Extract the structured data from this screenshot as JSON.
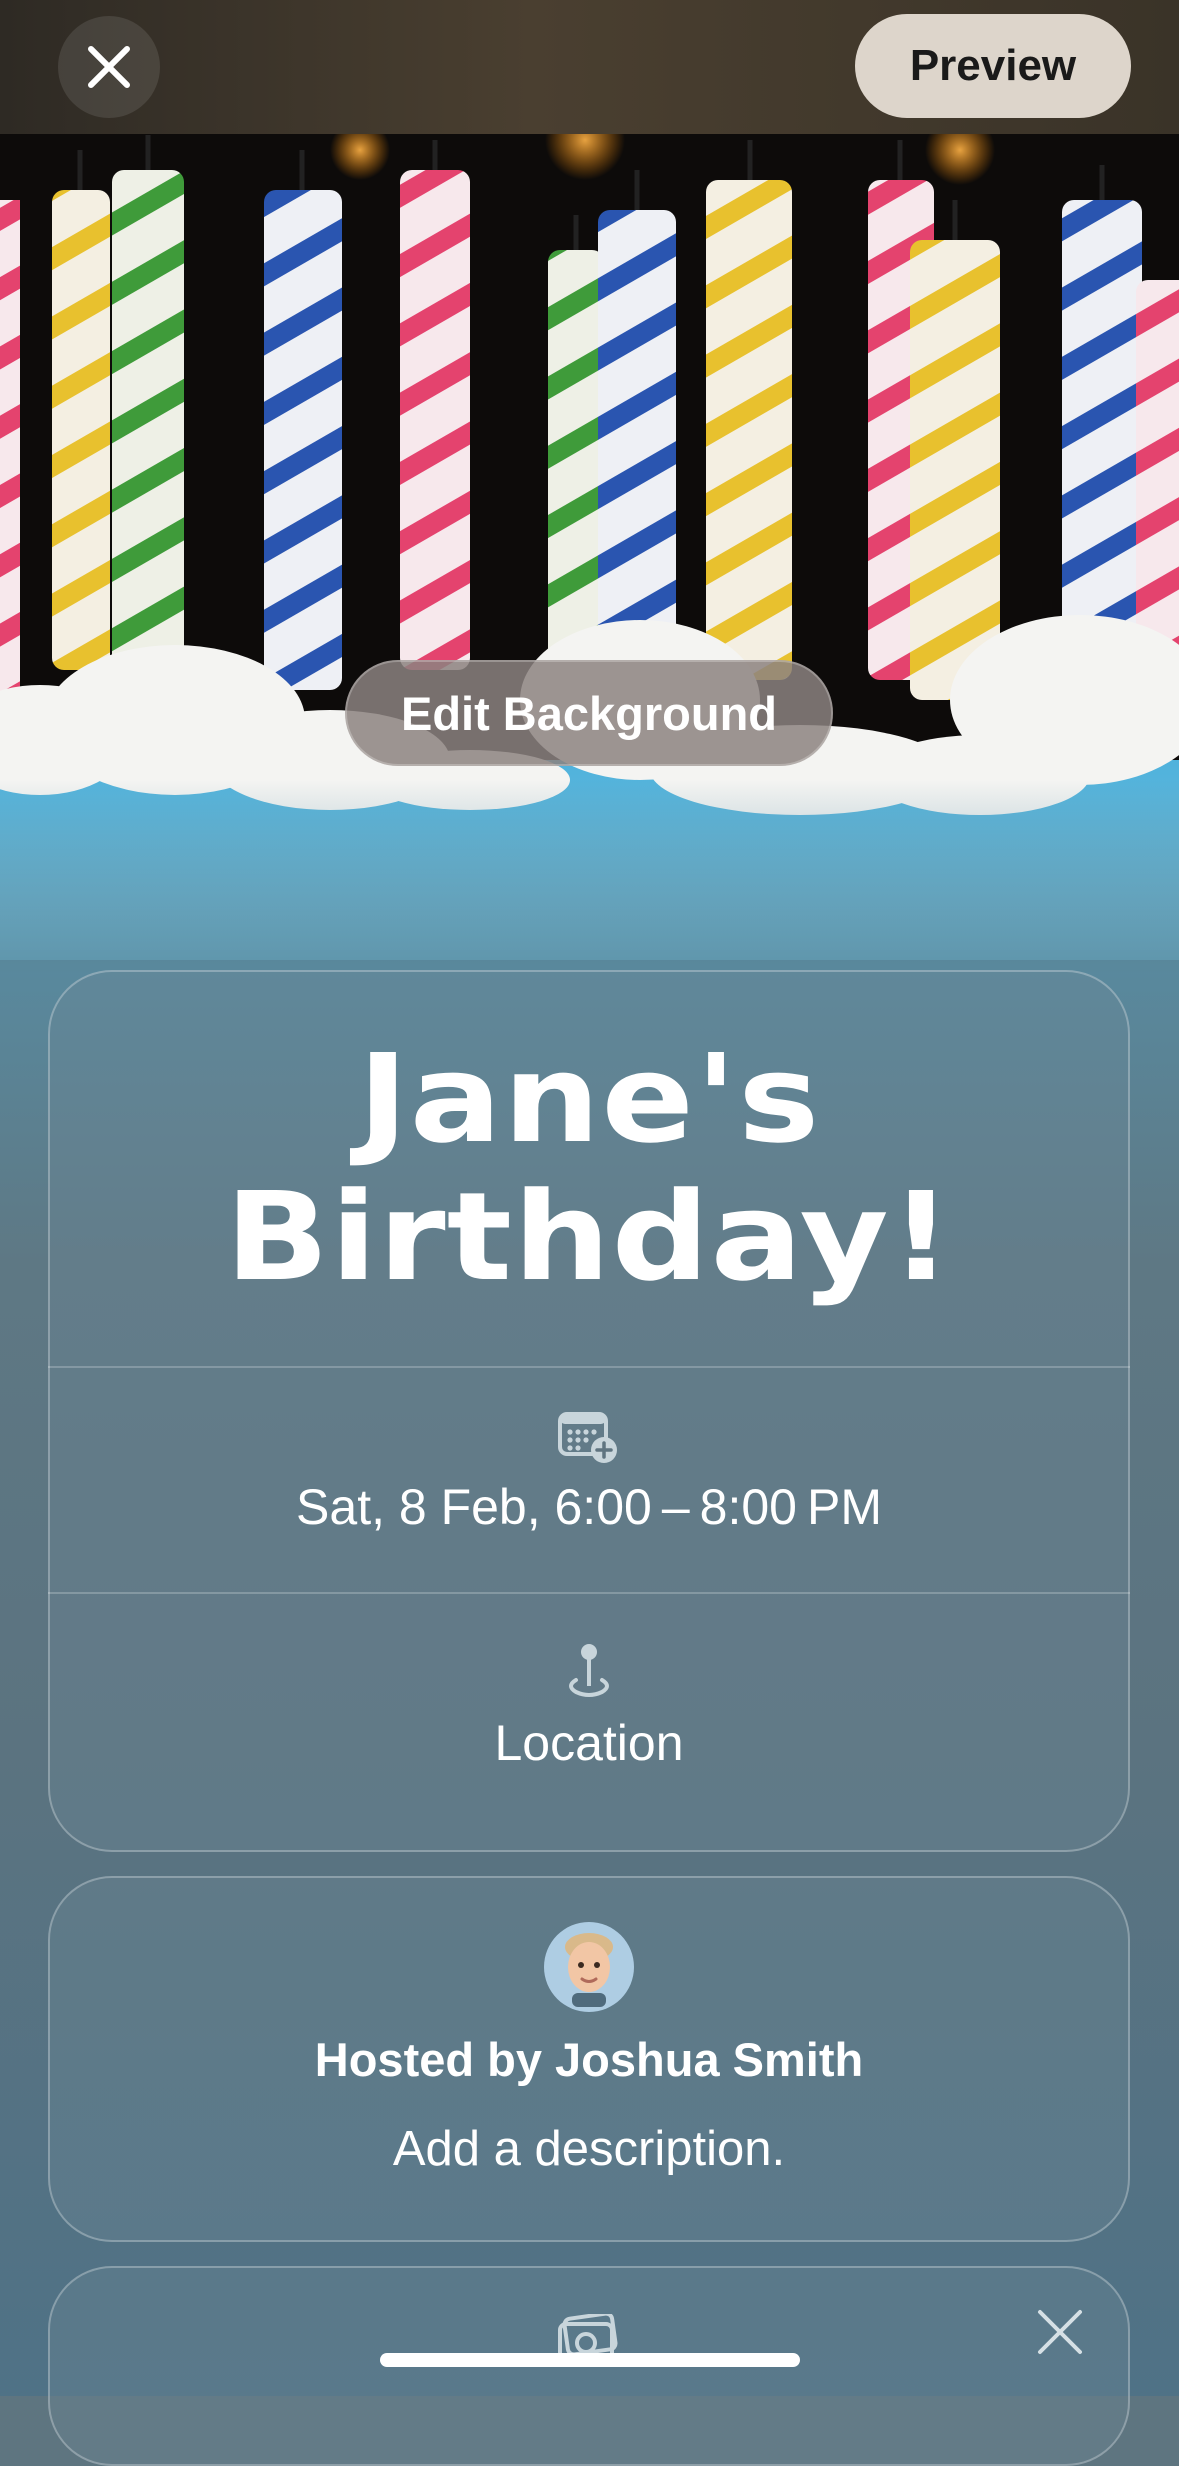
{
  "topbar": {
    "close_icon": "close-icon",
    "preview_label": "Preview"
  },
  "background": {
    "edit_label": "Edit Background"
  },
  "event": {
    "title_line1": "Jane's",
    "title_line2": "Birthday!",
    "date_icon": "calendar-add-icon",
    "date_text": "Sat, 8 Feb, 6:00 – 8:00 PM",
    "location_icon": "location-pin-icon",
    "location_text": "Location"
  },
  "host": {
    "avatar_icon": "memoji-avatar",
    "name": "Hosted by Joshua Smith",
    "description_placeholder": "Add a description."
  },
  "photos_card": {
    "icon": "photos-icon",
    "dismiss_icon": "close-icon"
  },
  "colors": {
    "preview_bg": "#ddd5cb",
    "card_tint": "#6e8794",
    "text": "#ffffff"
  }
}
